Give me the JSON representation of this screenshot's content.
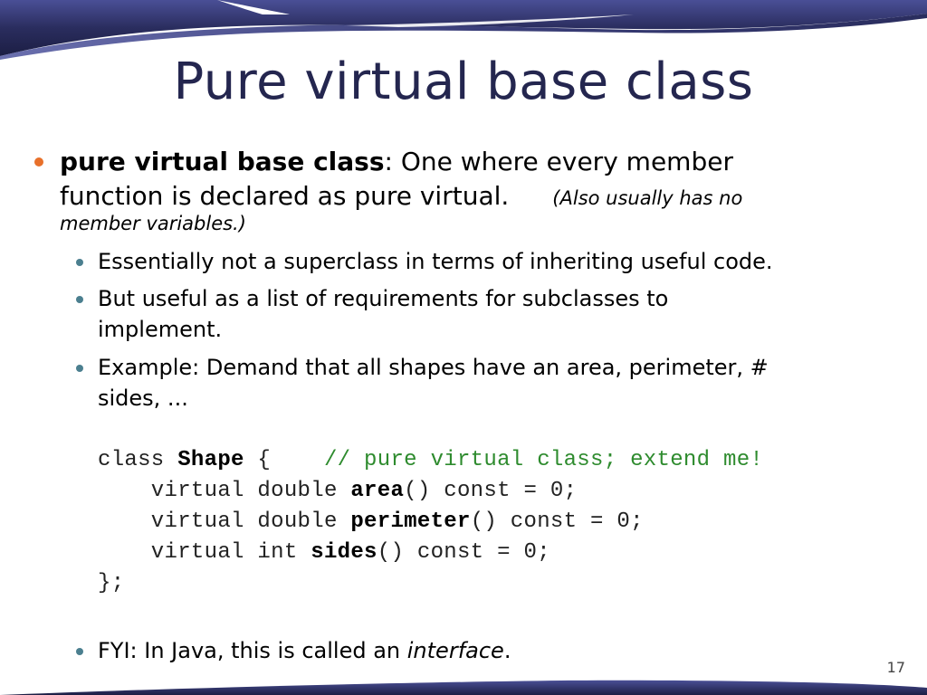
{
  "slide": {
    "title": "Pure virtual base class",
    "page_number": "17",
    "colors": {
      "title": "#24264f",
      "banner": "#2a2d5e",
      "bullet_level1": "#e8702a",
      "bullet_level2": "#4b7f8f",
      "code_comment": "#2e8b2e"
    }
  },
  "main_bullet": {
    "term": "pure virtual base class",
    "definition_line1": ": One where every member",
    "definition_line2": "function is declared as pure virtual.",
    "note_part1": "(Also usually has no",
    "note_part2": "member variables.)"
  },
  "sub_bullets": [
    {
      "lines": [
        "Essentially not a superclass in terms of inheriting useful code."
      ]
    },
    {
      "lines": [
        "But useful as a list of requirements for subclasses to",
        "implement."
      ]
    },
    {
      "lines": [
        "Example: Demand that all shapes have an area, perimeter, #",
        "sides, ..."
      ]
    }
  ],
  "code": {
    "line1": {
      "kw": "class ",
      "name": "Shape",
      "brace": " {    ",
      "comment": "// pure virtual class; extend me!"
    },
    "line2": {
      "pre": "    virtual double ",
      "name": "area",
      "post": "() const = 0;"
    },
    "line3": {
      "pre": "    virtual double ",
      "name": "perimeter",
      "post": "() const = 0;"
    },
    "line4": {
      "pre": "    virtual int ",
      "name": "sides",
      "post": "() const = 0;"
    },
    "line5": "};"
  },
  "fyi": {
    "prefix": "FYI: In Java, this is called an ",
    "emphasis": "interface",
    "suffix": "."
  }
}
